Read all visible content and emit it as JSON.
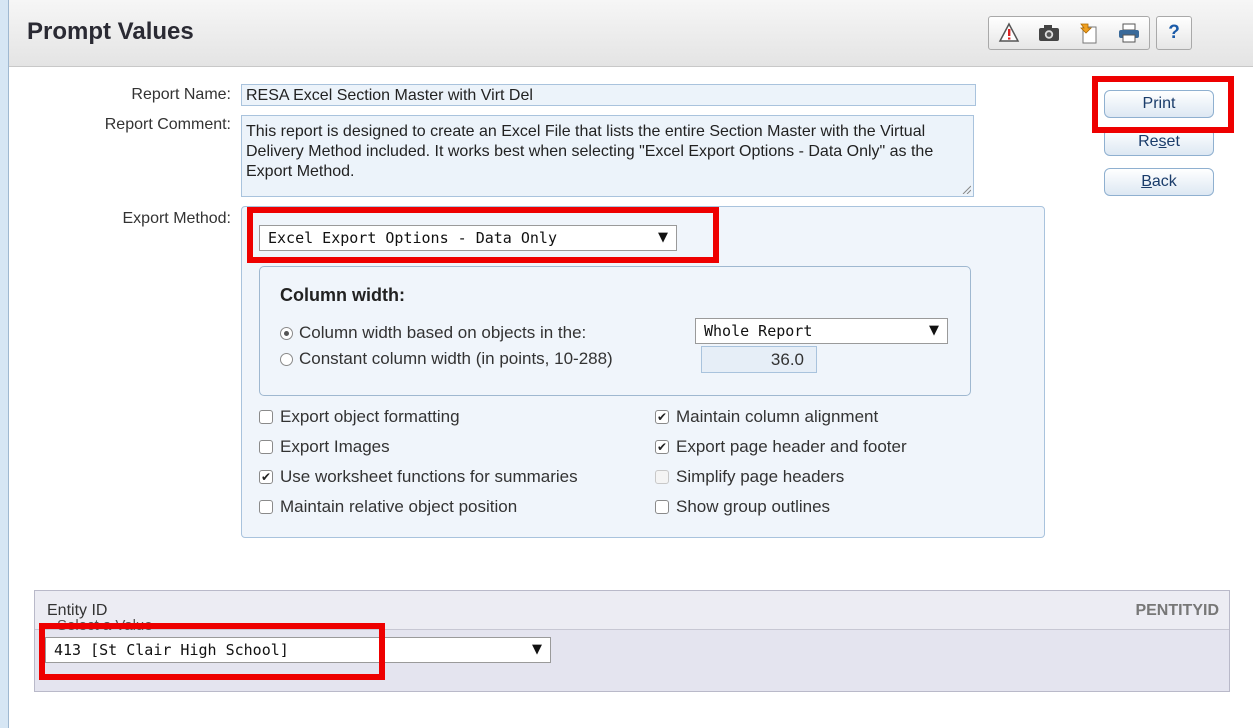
{
  "header": {
    "title": "Prompt Values",
    "toolbar": [
      "alert-icon",
      "camera-icon",
      "export-icon",
      "printer-icon",
      "help-icon"
    ],
    "help_label": "?"
  },
  "report": {
    "name_label": "Report Name:",
    "name_value": "RESA Excel Section Master with Virt Del",
    "comment_label": "Report Comment:",
    "comment_value": "This report is designed to create an Excel File that lists the entire Section Master with the Virtual Delivery Method included. It works best when selecting \"Excel Export Options - Data Only\" as the Export Method."
  },
  "buttons": {
    "print": "Print",
    "reset_pre": "Re",
    "reset_u": "s",
    "reset_post": "et",
    "back_u": "B",
    "back_post": "ack"
  },
  "export": {
    "label": "Export Method:",
    "selected": "Excel Export Options - Data Only",
    "column_width": {
      "title": "Column width:",
      "option1": "Column width based on objects in the:",
      "option1_selected": "Whole Report",
      "option2": "Constant column width (in points, 10-288)",
      "option2_value": "36.0"
    },
    "options": {
      "export_object_formatting": "Export object formatting",
      "export_images": "Export Images",
      "use_worksheet_functions": "Use worksheet functions for summaries",
      "maintain_relative_position": "Maintain relative object position",
      "maintain_column_alignment": "Maintain column alignment",
      "export_page_header_footer": "Export page header and footer",
      "simplify_page_headers": "Simplify page headers",
      "show_group_outlines": "Show group outlines"
    },
    "checked_mark": "✔"
  },
  "entity": {
    "label": "Entity ID",
    "code": "PENTITYID",
    "select_label": "Select a Value",
    "selected": "413 [St Clair High School]"
  },
  "colors": {
    "highlight": "#ee0000",
    "field_bg": "#ecf3fa",
    "panel_bg": "#f0f5fb"
  }
}
